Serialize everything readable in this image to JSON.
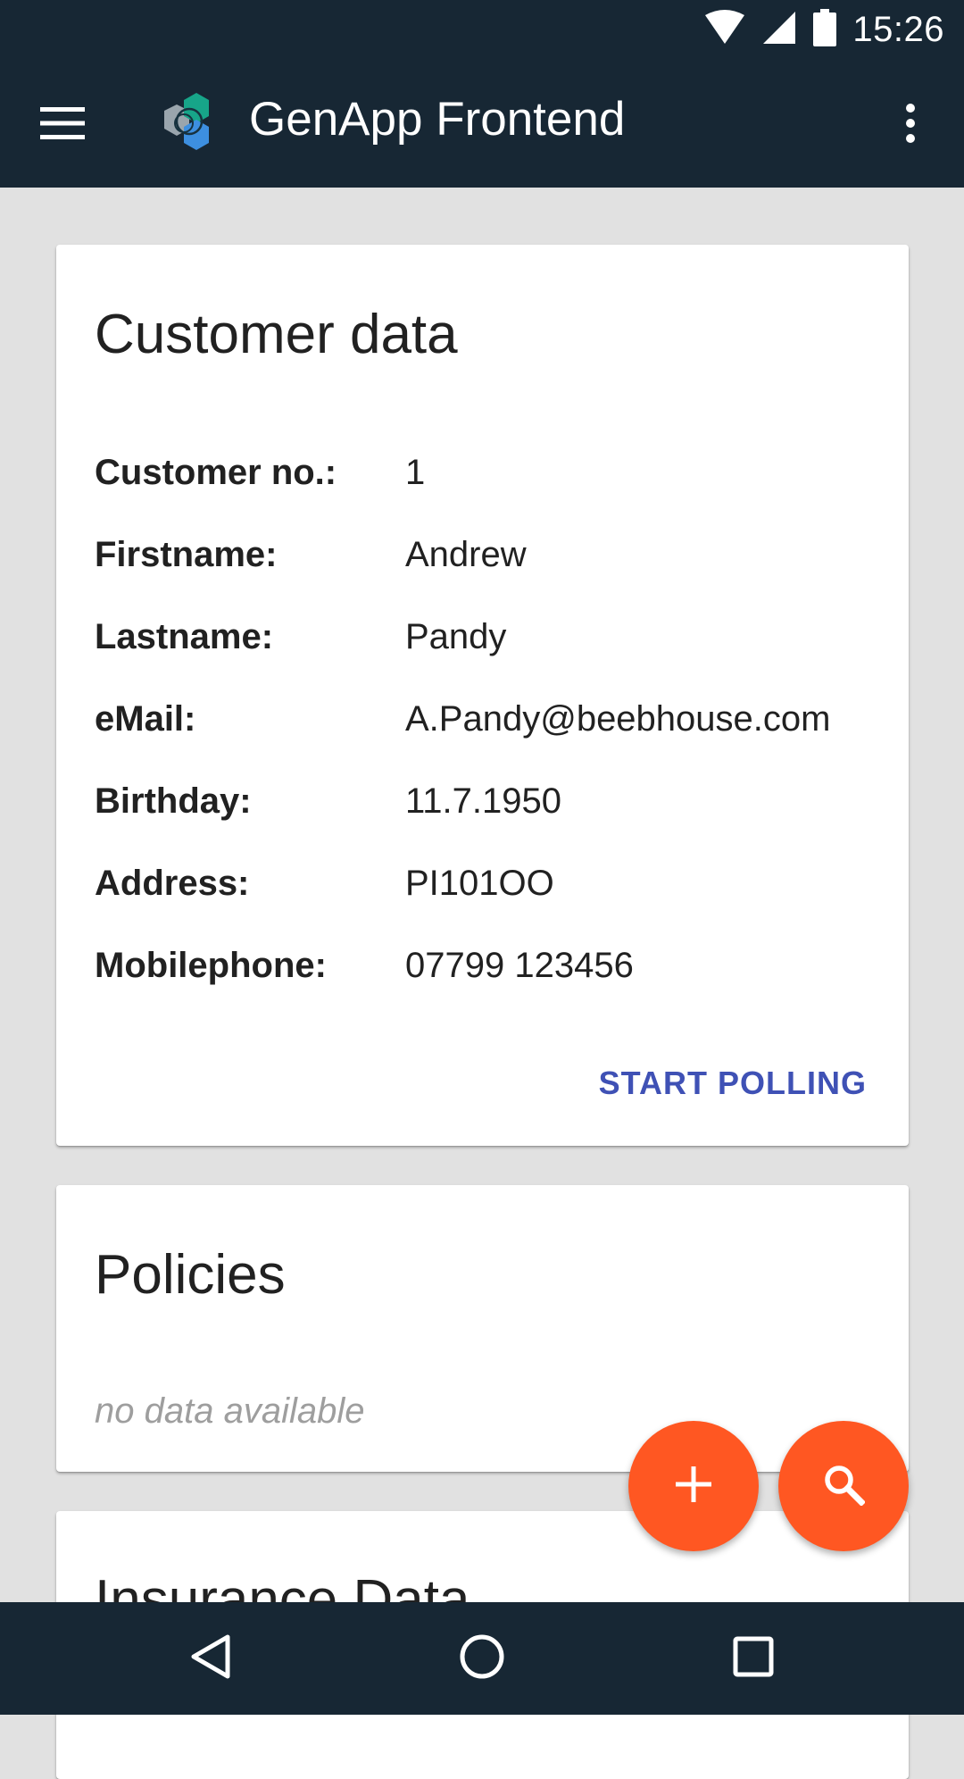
{
  "status_bar": {
    "time": "15:26",
    "icons": [
      "wifi-icon",
      "cellular-signal-icon",
      "battery-icon"
    ]
  },
  "app_bar": {
    "title": "GenApp Frontend",
    "icons": [
      "menu-icon",
      "app-logo",
      "more-vert-icon"
    ]
  },
  "customer_card": {
    "title": "Customer data",
    "fields": [
      {
        "label": "Customer no.:",
        "value": "1"
      },
      {
        "label": "Firstname:",
        "value": "Andrew"
      },
      {
        "label": "Lastname:",
        "value": "Pandy"
      },
      {
        "label": "eMail:",
        "value": "A.Pandy@beebhouse.com"
      },
      {
        "label": "Birthday:",
        "value": "11.7.1950"
      },
      {
        "label": "Address:",
        "value": "PI101OO"
      },
      {
        "label": "Mobilephone:",
        "value": "07799 123456"
      }
    ],
    "action_label": "START POLLING"
  },
  "policies_card": {
    "title": "Policies",
    "empty_text": "no data available"
  },
  "insurance_card": {
    "title": "Insurance Data"
  },
  "fabs": {
    "add_icon": "add-icon",
    "search_icon": "search-icon"
  },
  "nav_bar": {
    "icons": [
      "back-icon",
      "home-icon",
      "recents-icon"
    ]
  },
  "colors": {
    "bar_background": "#172734",
    "page_background": "#e1e1e1",
    "accent_fab": "#ff5722",
    "action_link": "#3f51b5",
    "muted_text": "#9e9e9e"
  }
}
